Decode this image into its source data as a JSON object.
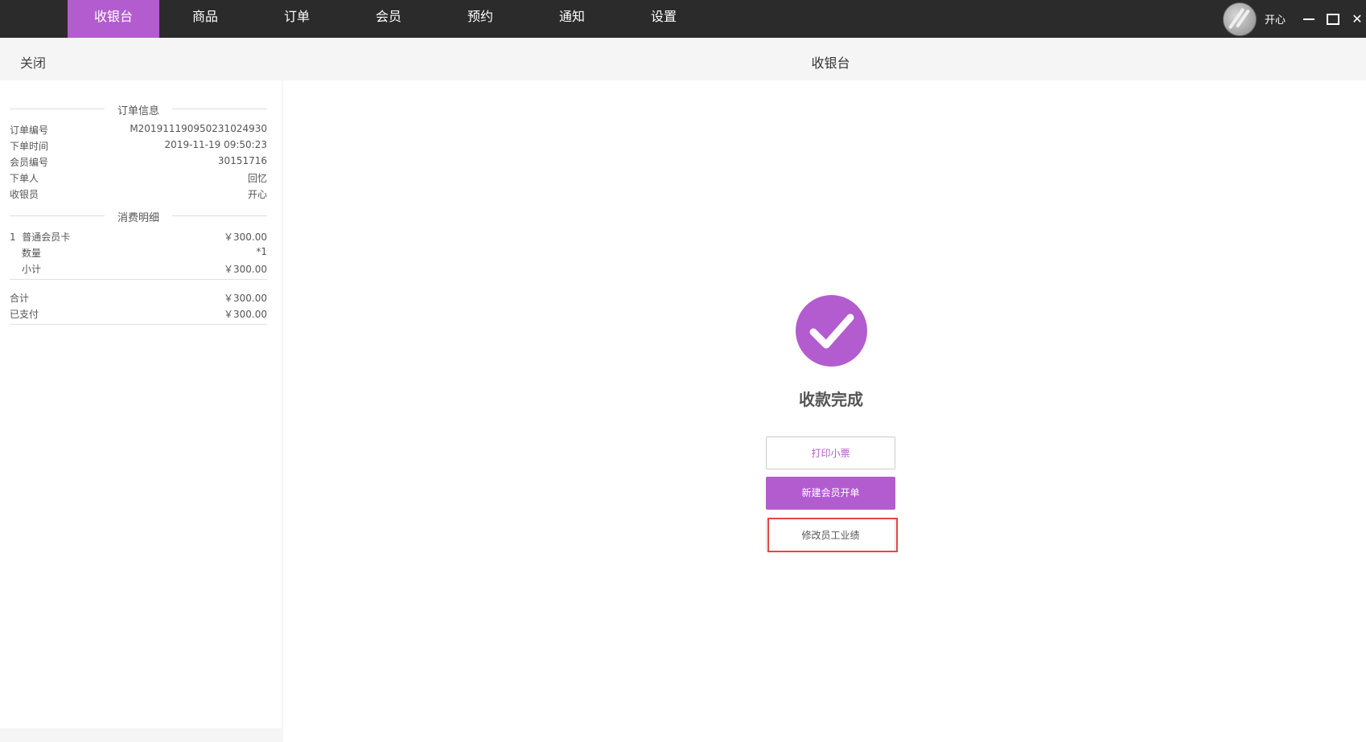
{
  "nav": {
    "items": [
      "收银台",
      "商品",
      "订单",
      "会员",
      "预约",
      "通知",
      "设置"
    ],
    "active_index": 0
  },
  "user": {
    "name": "开心"
  },
  "window_controls": {
    "close_glyph": "✕"
  },
  "subheader": {
    "close_label": "关闭",
    "title": "收银台"
  },
  "order_info": {
    "section_title": "订单信息",
    "fields": [
      {
        "label": "订单编号",
        "value": "M20191119095023102493​0"
      },
      {
        "label": "下单时间",
        "value": "2019-11-19 09:50:23"
      },
      {
        "label": "会员编号",
        "value": "30151716"
      },
      {
        "label": "下单人",
        "value": "回忆"
      },
      {
        "label": "收银员",
        "value": "开心"
      }
    ]
  },
  "consumption": {
    "section_title": "消费明细",
    "item": {
      "index": "1",
      "name": "普通会员卡",
      "price": "￥300.00"
    },
    "quantity": {
      "label": "数量",
      "value": "*1"
    },
    "subtotal": {
      "label": "小计",
      "value": "￥300.00"
    },
    "total": {
      "label": "合计",
      "value": "￥300.00"
    },
    "paid": {
      "label": "已支付",
      "value": "￥300.00"
    }
  },
  "result": {
    "status_text": "收款完成",
    "print_label": "打印小票",
    "new_order_label": "新建会员开单",
    "edit_perf_label": "修改员工业绩"
  },
  "colors": {
    "accent": "#b35ccf",
    "topbar": "#2b2b2b",
    "highlight": "#e64545"
  }
}
